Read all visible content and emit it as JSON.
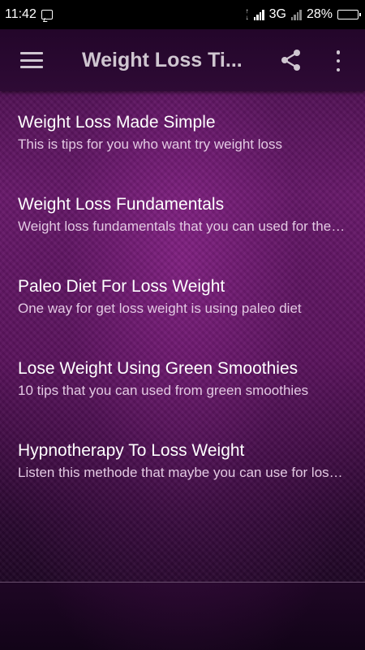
{
  "status_bar": {
    "time": "11:42",
    "network": "3G",
    "battery": "28%",
    "battery_level": 0.28
  },
  "app_bar": {
    "title": "Weight Loss Ti...",
    "menu_icon": "menu-icon",
    "share_icon": "share-icon",
    "more_icon": "more-vert-icon"
  },
  "list": {
    "items": [
      {
        "title": "Weight Loss Made Simple",
        "description": "This is tips for you who want try weight loss"
      },
      {
        "title": "Weight Loss Fundamentals",
        "description": "Weight loss fundamentals that you can used for the first time"
      },
      {
        "title": "Paleo Diet For Loss Weight",
        "description": "One way for get loss weight is using paleo diet"
      },
      {
        "title": "Lose Weight Using Green Smoothies",
        "description": "10 tips that you can used from green smoothies"
      },
      {
        "title": "Hypnotherapy To Loss Weight",
        "description": "Listen this methode that maybe you can use for loss weight"
      }
    ]
  },
  "colors": {
    "background": "#5a135c",
    "app_bar": "#2a0832",
    "title_text": "#ffffff",
    "description_text": "#e3c9e3"
  }
}
